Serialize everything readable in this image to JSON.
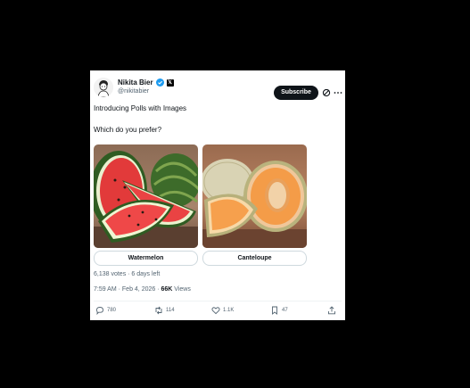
{
  "author": {
    "name": "Nikita Bier",
    "handle": "@nikitabier"
  },
  "header": {
    "subscribe_label": "Subscribe",
    "icons": [
      "verified-icon",
      "x-badge-icon",
      "grok-icon",
      "more-icon"
    ]
  },
  "post": {
    "text_line1": "Introducing Polls with Images",
    "text_line2": "Which do you prefer?"
  },
  "poll": {
    "options": [
      {
        "label": "Watermelon",
        "image": "watermelon-image"
      },
      {
        "label": "Canteloupe",
        "image": "cantaloupe-image"
      }
    ],
    "votes_summary": "6,138 votes · 6 days left"
  },
  "meta": {
    "time_date": "7:59 AM · Feb 4, 2026 · ",
    "views_count": "66K",
    "views_label": " Views"
  },
  "actions": {
    "replies": "780",
    "reposts": "114",
    "likes": "1.1K",
    "bookmarks": "47"
  },
  "colors": {
    "background": "#000000",
    "card": "#ffffff",
    "text": "#0f1419",
    "muted": "#536471",
    "verified": "#1d9bf0"
  }
}
